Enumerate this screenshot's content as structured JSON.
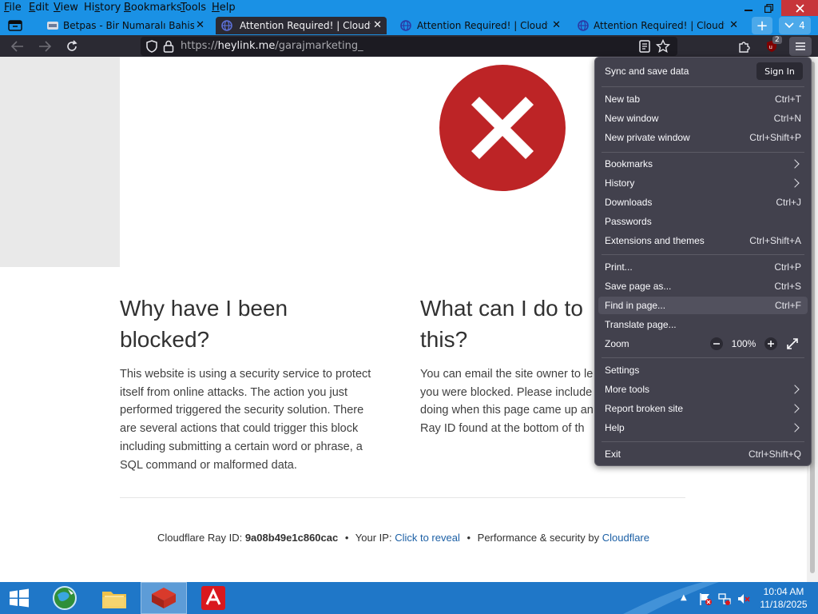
{
  "menubar": {
    "items": [
      {
        "accel": "F",
        "rest": "ile"
      },
      {
        "accel": "E",
        "rest": "dit"
      },
      {
        "accel": "V",
        "rest": "iew"
      },
      {
        "pre": "Hi",
        "accel": "s",
        "rest": "tory"
      },
      {
        "accel": "B",
        "rest": "ookmarks"
      },
      {
        "accel": "T",
        "rest": "ools"
      },
      {
        "accel": "H",
        "rest": "elp"
      }
    ]
  },
  "tabs": [
    {
      "title": "Betpas - Bir Numaralı Bahis Plat",
      "active": false
    },
    {
      "title": "Attention Required! | Cloudflare",
      "active": true
    },
    {
      "title": "Attention Required! | Cloudflare",
      "active": false
    },
    {
      "title": "Attention Required! | Cloudflare",
      "active": false
    }
  ],
  "tab_overflow": {
    "count": "4"
  },
  "toolbar": {
    "ublock_badge": "2"
  },
  "urlbar": {
    "scheme": "https://",
    "host": "heylink.me",
    "path": "/garajmarketing_"
  },
  "page": {
    "why_heading_line1": "Why have I been",
    "why_heading_line2": "blocked?",
    "why_body": [
      "This website is using a security service to protect",
      "itself from online attacks. The action you just",
      "performed triggered the security solution. There",
      "are several actions that could trigger this block",
      "including submitting a certain word or phrase, a",
      "SQL command or malformed data."
    ],
    "what_heading_line1": "What can I do to",
    "what_heading_line2": "this?",
    "what_body": [
      "You can email the site owner to le",
      "you were blocked. Please include",
      "doing when this page came up an",
      "Ray ID found at the bottom of th"
    ],
    "footer": {
      "ray_label": "Cloudflare Ray ID:",
      "ray_id": "9a08b49e1c860cac",
      "ip_label": "Your IP:",
      "ip_link": "Click to reveal",
      "perf_label": "Performance & security by",
      "cf_link": "Cloudflare",
      "bullet": "•"
    }
  },
  "app_menu": {
    "sync_label": "Sync and save data",
    "signin_label": "Sign In",
    "items": [
      {
        "label": "New tab",
        "shortcut": "Ctrl+T"
      },
      {
        "label": "New window",
        "shortcut": "Ctrl+N"
      },
      {
        "label": "New private window",
        "shortcut": "Ctrl+Shift+P"
      },
      {
        "label": "Bookmarks",
        "shortcut": ""
      },
      {
        "label": "History",
        "shortcut": ""
      },
      {
        "label": "Downloads",
        "shortcut": "Ctrl+J"
      },
      {
        "label": "Passwords",
        "shortcut": ""
      },
      {
        "label": "Extensions and themes",
        "shortcut": "Ctrl+Shift+A"
      },
      {
        "label": "Print...",
        "shortcut": "Ctrl+P"
      },
      {
        "label": "Save page as...",
        "shortcut": "Ctrl+S"
      },
      {
        "label": "Find in page...",
        "shortcut": "Ctrl+F"
      },
      {
        "label": "Translate page...",
        "shortcut": ""
      },
      {
        "label": "Zoom",
        "shortcut": ""
      },
      {
        "label": "Settings",
        "shortcut": ""
      },
      {
        "label": "More tools",
        "shortcut": ""
      },
      {
        "label": "Report broken site",
        "shortcut": ""
      },
      {
        "label": "Help",
        "shortcut": ""
      },
      {
        "label": "Exit",
        "shortcut": "Ctrl+Shift+Q"
      }
    ],
    "zoom_value": "100%"
  },
  "taskbar": {
    "clock_time": "10:04 AM",
    "clock_date": "11/18/2025"
  },
  "colors": {
    "titlebar": "#1a91e5",
    "toolbar": "#2b2a33",
    "menu_bg": "#42414d",
    "error_red": "#bd2426",
    "link_blue": "#1b5fa5",
    "taskbar": "#1f77c8"
  }
}
